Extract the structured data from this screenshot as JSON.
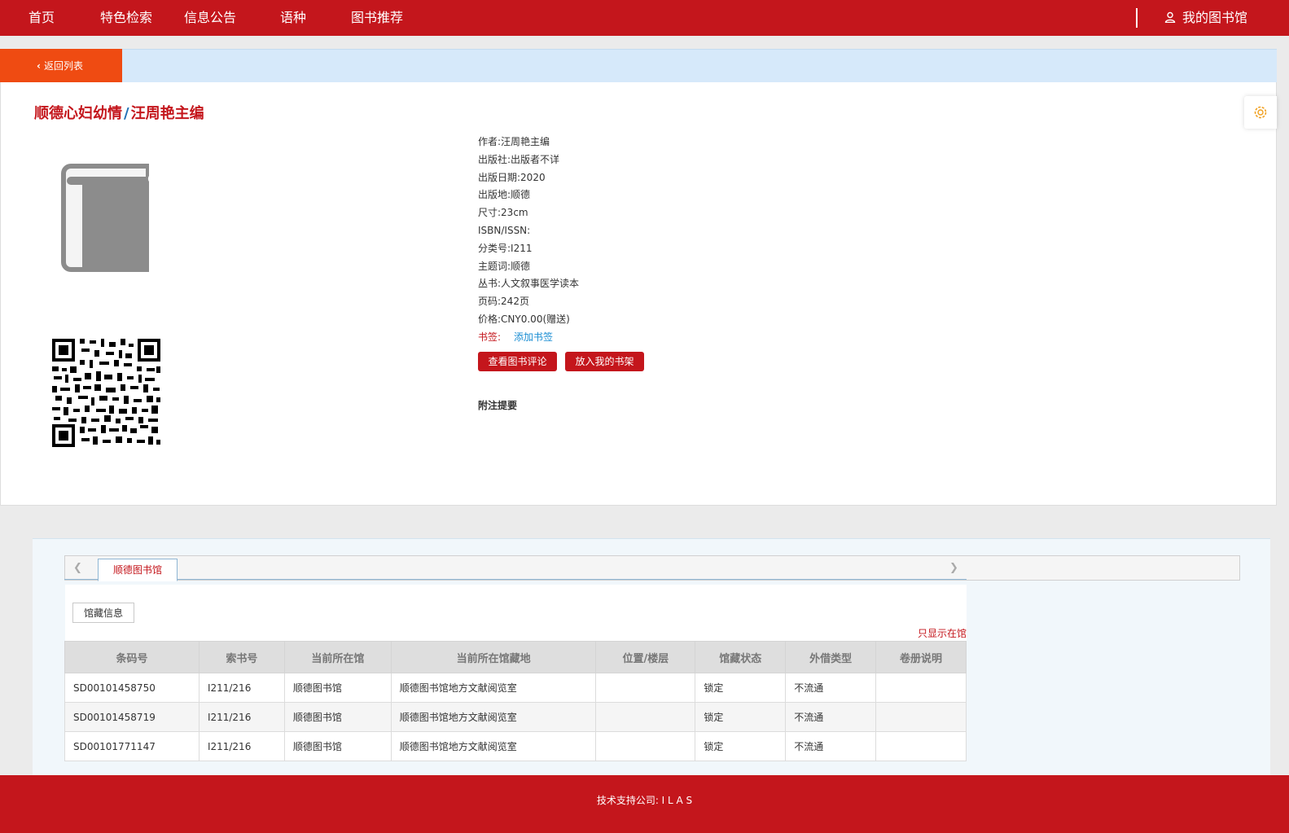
{
  "nav": {
    "items": [
      {
        "label": "首页"
      },
      {
        "label": "特色检索"
      },
      {
        "label": "信息公告"
      },
      {
        "label": "语种"
      },
      {
        "label": "图书推荐"
      }
    ],
    "my_library": "我的图书馆"
  },
  "back_label": "返回列表",
  "book": {
    "title": "顺德心妇幼情",
    "slash": "/",
    "responsibility": "汪周艳主编",
    "fields": [
      {
        "label": "作者:",
        "value": "汪周艳主编"
      },
      {
        "label": "出版社:",
        "value": "出版者不详"
      },
      {
        "label": "出版日期:",
        "value": "2020"
      },
      {
        "label": "出版地:",
        "value": "顺德"
      },
      {
        "label": "尺寸:",
        "value": "23cm"
      },
      {
        "label": "ISBN/ISSN:",
        "value": ""
      },
      {
        "label": "分类号:",
        "value": "I211"
      },
      {
        "label": "主题词:",
        "value": "顺德"
      },
      {
        "label": "丛书:",
        "value": "人文叙事医学读本"
      },
      {
        "label": "页码:",
        "value": "242页"
      },
      {
        "label": "价格:",
        "value": "CNY0.00(赠送)"
      }
    ],
    "bookmark_label": "书签:",
    "add_bookmark": "添加书签",
    "view_reviews": "查看图书评论",
    "add_to_shelf": "放入我的书架",
    "notes_heading": "附注提要"
  },
  "holdings": {
    "library_tab": "顺德图书馆",
    "sub_tab": "馆藏信息",
    "only_available": "只显示在馆",
    "columns": [
      "条码号",
      "索书号",
      "当前所在馆",
      "当前所在馆藏地",
      "位置/楼层",
      "馆藏状态",
      "外借类型",
      "卷册说明"
    ],
    "rows": [
      [
        "SD00101458750",
        "I211/216",
        "顺德图书馆",
        "顺德图书馆地方文献阅览室",
        "",
        "锁定",
        "不流通",
        ""
      ],
      [
        "SD00101458719",
        "I211/216",
        "顺德图书馆",
        "顺德图书馆地方文献阅览室",
        "",
        "锁定",
        "不流通",
        ""
      ],
      [
        "SD00101771147",
        "I211/216",
        "顺德图书馆",
        "顺德图书馆地方文献阅览室",
        "",
        "锁定",
        "不流通",
        ""
      ]
    ]
  },
  "footer": {
    "text": "技术支持公司: I L A S"
  },
  "colors": {
    "brand_red": "#c4161c",
    "back_orange": "#ef4b12",
    "link_blue": "#1b8ed3"
  }
}
